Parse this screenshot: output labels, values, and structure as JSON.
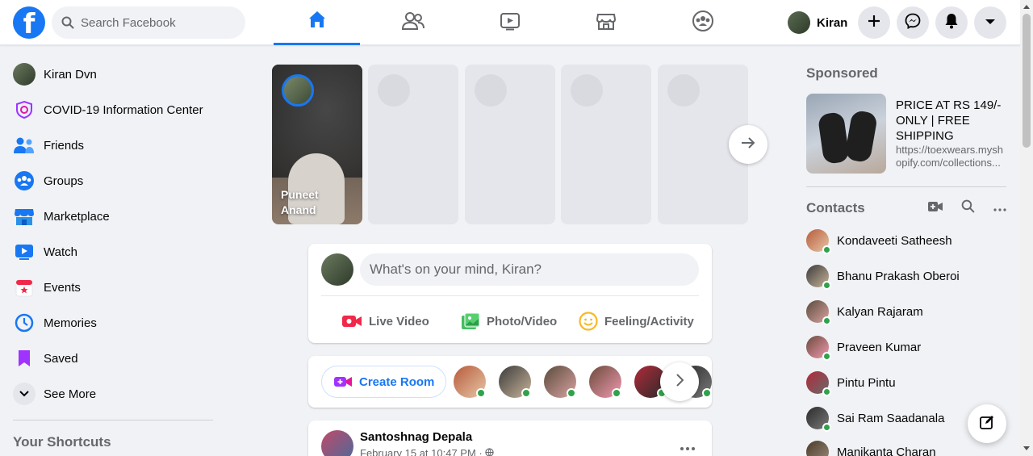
{
  "app": {
    "logo": "f",
    "brand_color": "#1877f2"
  },
  "search": {
    "placeholder": "Search Facebook"
  },
  "nav_tabs": [
    {
      "name": "home",
      "icon": "home-icon",
      "active": true
    },
    {
      "name": "friends",
      "icon": "friends-icon",
      "active": false
    },
    {
      "name": "watch",
      "icon": "watch-icon",
      "active": false
    },
    {
      "name": "marketplace",
      "icon": "marketplace-icon",
      "active": false
    },
    {
      "name": "groups",
      "icon": "groups-icon",
      "active": false
    }
  ],
  "user": {
    "first_name": "Kiran",
    "full_name": "Kiran Dvn"
  },
  "top_actions": [
    "plus-icon",
    "messenger-icon",
    "bell-icon",
    "chevron-down-icon"
  ],
  "sidebar": {
    "items": [
      {
        "label": "Kiran Dvn",
        "icon": "avatar"
      },
      {
        "label": "COVID-19 Information Center",
        "icon": "covid-shield-icon"
      },
      {
        "label": "Friends",
        "icon": "friends-icon"
      },
      {
        "label": "Groups",
        "icon": "groups-icon"
      },
      {
        "label": "Marketplace",
        "icon": "marketplace-icon"
      },
      {
        "label": "Watch",
        "icon": "watch-icon"
      },
      {
        "label": "Events",
        "icon": "events-icon"
      },
      {
        "label": "Memories",
        "icon": "memories-clock-icon"
      },
      {
        "label": "Saved",
        "icon": "saved-bookmark-icon"
      },
      {
        "label": "See More",
        "icon": "chevron-down-icon"
      }
    ],
    "shortcuts_title": "Your Shortcuts"
  },
  "stories": {
    "first_name": "Puneet Anand",
    "placeholder_count": 4
  },
  "composer": {
    "placeholder": "What's on your mind, Kiran?",
    "actions": [
      {
        "label": "Live Video",
        "icon": "live-video-icon",
        "color": "#f02849"
      },
      {
        "label": "Photo/Video",
        "icon": "photo-icon",
        "color": "#45bd62"
      },
      {
        "label": "Feeling/Activity",
        "icon": "feeling-icon",
        "color": "#f7b928"
      }
    ]
  },
  "rooms": {
    "create_label": "Create Room",
    "avatar_count": 6
  },
  "post": {
    "author": "Santoshnag Depala",
    "time": "February 15 at 10:47 PM · "
  },
  "sponsored": {
    "title": "Sponsored",
    "ad_title": "PRICE AT RS 149/- ONLY | FREE SHIPPING",
    "ad_url": "https://toexwears.myshopify.com/collections..."
  },
  "contacts": {
    "title": "Contacts",
    "items": [
      "Kondaveeti Satheesh",
      "Bhanu Prakash Oberoi",
      "Kalyan Rajaram",
      "Praveen Kumar",
      "Pintu Pintu",
      "Sai Ram Saadanala",
      "Manikanta Charan"
    ]
  }
}
